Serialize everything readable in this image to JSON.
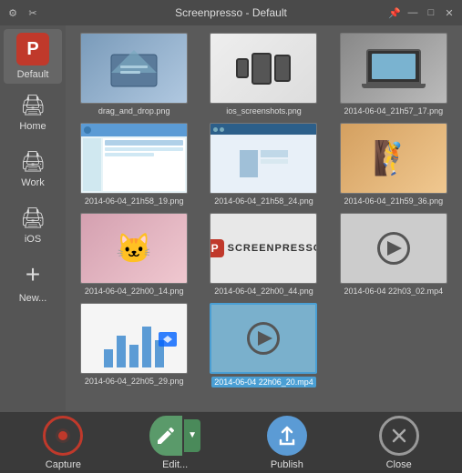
{
  "titleBar": {
    "title": "Screenpresso  -  Default",
    "icons": {
      "settings": "⚙",
      "pin": "📌",
      "minimize": "—",
      "maximize": "□",
      "close": "✕"
    }
  },
  "sidebar": {
    "items": [
      {
        "id": "default",
        "label": "Default",
        "icon": "P",
        "active": true
      },
      {
        "id": "home",
        "label": "Home",
        "icon": "🖨"
      },
      {
        "id": "work",
        "label": "Work",
        "icon": "🖨"
      },
      {
        "id": "ios",
        "label": "iOS",
        "icon": "🖨"
      },
      {
        "id": "new",
        "label": "New...",
        "icon": "+"
      }
    ]
  },
  "thumbnails": [
    {
      "id": "t1",
      "label": "drag_and_drop.png",
      "type": "drag_drop",
      "selected": false
    },
    {
      "id": "t2",
      "label": "ios_screenshots.png",
      "type": "ios",
      "selected": false
    },
    {
      "id": "t3",
      "label": "2014-06-04_21h57_17.png",
      "type": "laptop",
      "selected": false
    },
    {
      "id": "t4",
      "label": "2014-06-04_21h58_19.png",
      "type": "interface",
      "selected": false
    },
    {
      "id": "t5",
      "label": "2014-06-04_21h58_24.png",
      "type": "screenshot2",
      "selected": false
    },
    {
      "id": "t6",
      "label": "2014-06-04_21h59_36.png",
      "type": "person",
      "selected": false
    },
    {
      "id": "t7",
      "label": "2014-06-04_22h00_14.png",
      "type": "cat",
      "selected": false
    },
    {
      "id": "t8",
      "label": "2014-06-04_22h00_44.png",
      "type": "screenpresso",
      "selected": false
    },
    {
      "id": "t9",
      "label": "2014-06-04 22h03_02.mp4",
      "type": "video",
      "selected": false
    },
    {
      "id": "t10",
      "label": "2014-06-04_22h05_29.png",
      "type": "chart",
      "selected": false
    },
    {
      "id": "t11",
      "label": "2014-06-04 22h06_20.mp4",
      "type": "video2",
      "selected": true
    }
  ],
  "bottomBar": {
    "capture": "Capture",
    "edit": "Edit...",
    "publish": "Publish",
    "close": "Close"
  }
}
